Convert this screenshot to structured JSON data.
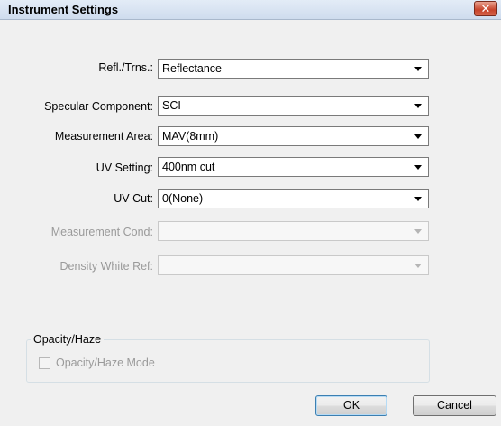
{
  "window": {
    "title": "Instrument Settings",
    "close_glyph": "✕"
  },
  "fields": [
    {
      "label": "Refl./Trns.:",
      "value": "Reflectance",
      "enabled": true
    },
    {
      "label": "Specular Component:",
      "value": "SCI",
      "enabled": true
    },
    {
      "label": "Measurement Area:",
      "value": "MAV(8mm)",
      "enabled": true
    },
    {
      "label": "UV Setting:",
      "value": "400nm cut",
      "enabled": true
    },
    {
      "label": "UV Cut:",
      "value": "0(None)",
      "enabled": true
    },
    {
      "label": "Measurement Cond:",
      "value": "",
      "enabled": false
    },
    {
      "label": "Density White Ref:",
      "value": "",
      "enabled": false
    }
  ],
  "opacity_group": {
    "title": "Opacity/Haze",
    "checkbox_label": "Opacity/Haze Mode",
    "checked": false,
    "enabled": false
  },
  "buttons": {
    "ok": "OK",
    "cancel": "Cancel"
  }
}
